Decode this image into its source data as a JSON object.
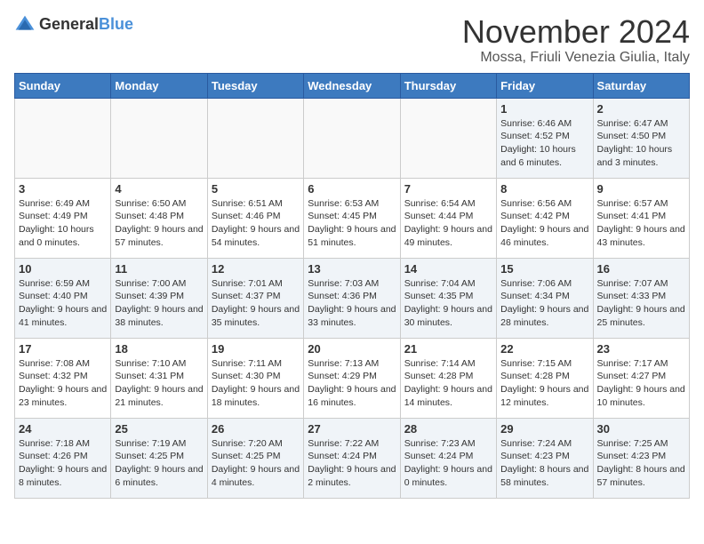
{
  "logo": {
    "text_general": "General",
    "text_blue": "Blue"
  },
  "header": {
    "title": "November 2024",
    "subtitle": "Mossa, Friuli Venezia Giulia, Italy"
  },
  "weekdays": [
    "Sunday",
    "Monday",
    "Tuesday",
    "Wednesday",
    "Thursday",
    "Friday",
    "Saturday"
  ],
  "weeks": [
    [
      {
        "day": "",
        "info": ""
      },
      {
        "day": "",
        "info": ""
      },
      {
        "day": "",
        "info": ""
      },
      {
        "day": "",
        "info": ""
      },
      {
        "day": "",
        "info": ""
      },
      {
        "day": "1",
        "info": "Sunrise: 6:46 AM\nSunset: 4:52 PM\nDaylight: 10 hours and 6 minutes."
      },
      {
        "day": "2",
        "info": "Sunrise: 6:47 AM\nSunset: 4:50 PM\nDaylight: 10 hours and 3 minutes."
      }
    ],
    [
      {
        "day": "3",
        "info": "Sunrise: 6:49 AM\nSunset: 4:49 PM\nDaylight: 10 hours and 0 minutes."
      },
      {
        "day": "4",
        "info": "Sunrise: 6:50 AM\nSunset: 4:48 PM\nDaylight: 9 hours and 57 minutes."
      },
      {
        "day": "5",
        "info": "Sunrise: 6:51 AM\nSunset: 4:46 PM\nDaylight: 9 hours and 54 minutes."
      },
      {
        "day": "6",
        "info": "Sunrise: 6:53 AM\nSunset: 4:45 PM\nDaylight: 9 hours and 51 minutes."
      },
      {
        "day": "7",
        "info": "Sunrise: 6:54 AM\nSunset: 4:44 PM\nDaylight: 9 hours and 49 minutes."
      },
      {
        "day": "8",
        "info": "Sunrise: 6:56 AM\nSunset: 4:42 PM\nDaylight: 9 hours and 46 minutes."
      },
      {
        "day": "9",
        "info": "Sunrise: 6:57 AM\nSunset: 4:41 PM\nDaylight: 9 hours and 43 minutes."
      }
    ],
    [
      {
        "day": "10",
        "info": "Sunrise: 6:59 AM\nSunset: 4:40 PM\nDaylight: 9 hours and 41 minutes."
      },
      {
        "day": "11",
        "info": "Sunrise: 7:00 AM\nSunset: 4:39 PM\nDaylight: 9 hours and 38 minutes."
      },
      {
        "day": "12",
        "info": "Sunrise: 7:01 AM\nSunset: 4:37 PM\nDaylight: 9 hours and 35 minutes."
      },
      {
        "day": "13",
        "info": "Sunrise: 7:03 AM\nSunset: 4:36 PM\nDaylight: 9 hours and 33 minutes."
      },
      {
        "day": "14",
        "info": "Sunrise: 7:04 AM\nSunset: 4:35 PM\nDaylight: 9 hours and 30 minutes."
      },
      {
        "day": "15",
        "info": "Sunrise: 7:06 AM\nSunset: 4:34 PM\nDaylight: 9 hours and 28 minutes."
      },
      {
        "day": "16",
        "info": "Sunrise: 7:07 AM\nSunset: 4:33 PM\nDaylight: 9 hours and 25 minutes."
      }
    ],
    [
      {
        "day": "17",
        "info": "Sunrise: 7:08 AM\nSunset: 4:32 PM\nDaylight: 9 hours and 23 minutes."
      },
      {
        "day": "18",
        "info": "Sunrise: 7:10 AM\nSunset: 4:31 PM\nDaylight: 9 hours and 21 minutes."
      },
      {
        "day": "19",
        "info": "Sunrise: 7:11 AM\nSunset: 4:30 PM\nDaylight: 9 hours and 18 minutes."
      },
      {
        "day": "20",
        "info": "Sunrise: 7:13 AM\nSunset: 4:29 PM\nDaylight: 9 hours and 16 minutes."
      },
      {
        "day": "21",
        "info": "Sunrise: 7:14 AM\nSunset: 4:28 PM\nDaylight: 9 hours and 14 minutes."
      },
      {
        "day": "22",
        "info": "Sunrise: 7:15 AM\nSunset: 4:28 PM\nDaylight: 9 hours and 12 minutes."
      },
      {
        "day": "23",
        "info": "Sunrise: 7:17 AM\nSunset: 4:27 PM\nDaylight: 9 hours and 10 minutes."
      }
    ],
    [
      {
        "day": "24",
        "info": "Sunrise: 7:18 AM\nSunset: 4:26 PM\nDaylight: 9 hours and 8 minutes."
      },
      {
        "day": "25",
        "info": "Sunrise: 7:19 AM\nSunset: 4:25 PM\nDaylight: 9 hours and 6 minutes."
      },
      {
        "day": "26",
        "info": "Sunrise: 7:20 AM\nSunset: 4:25 PM\nDaylight: 9 hours and 4 minutes."
      },
      {
        "day": "27",
        "info": "Sunrise: 7:22 AM\nSunset: 4:24 PM\nDaylight: 9 hours and 2 minutes."
      },
      {
        "day": "28",
        "info": "Sunrise: 7:23 AM\nSunset: 4:24 PM\nDaylight: 9 hours and 0 minutes."
      },
      {
        "day": "29",
        "info": "Sunrise: 7:24 AM\nSunset: 4:23 PM\nDaylight: 8 hours and 58 minutes."
      },
      {
        "day": "30",
        "info": "Sunrise: 7:25 AM\nSunset: 4:23 PM\nDaylight: 8 hours and 57 minutes."
      }
    ]
  ]
}
